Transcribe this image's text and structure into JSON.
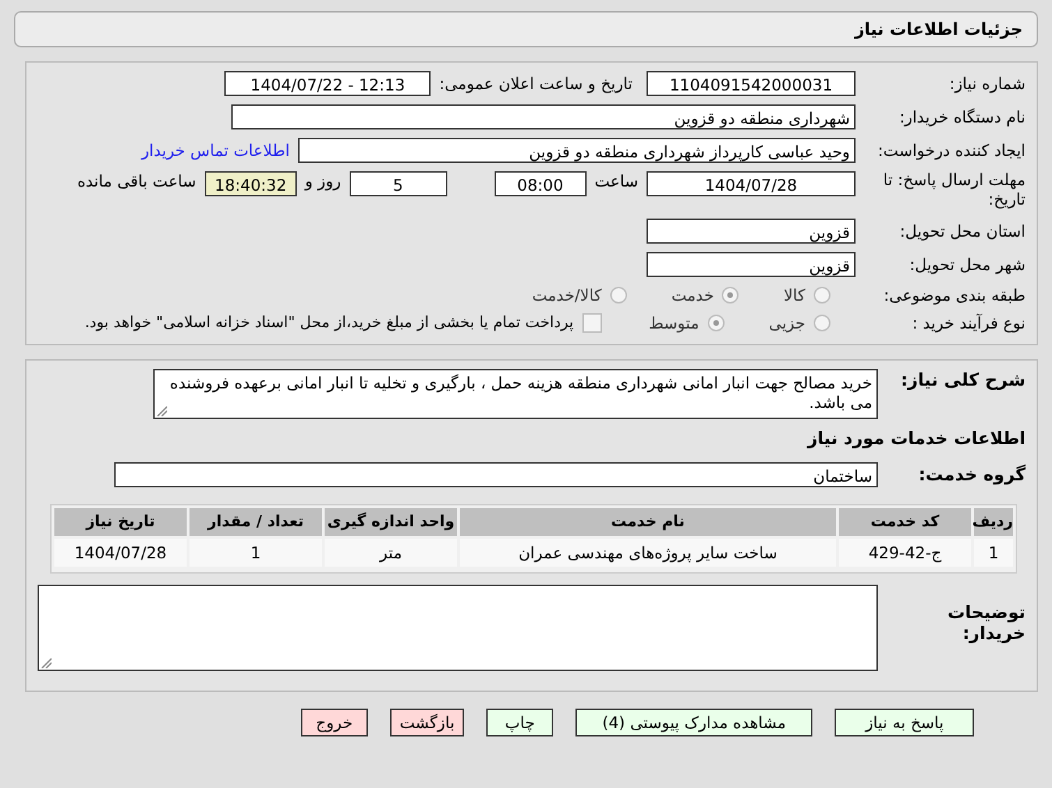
{
  "header": {
    "title": "جزئیات اطلاعات نیاز"
  },
  "need_number": {
    "label": "شماره نیاز:",
    "value": "1104091542000031"
  },
  "announce": {
    "label": "تاریخ و ساعت اعلان عمومی:",
    "value": "1404/07/22 - 12:13"
  },
  "buyer": {
    "label": "نام دستگاه خریدار:",
    "value": "شهرداری منطقه دو قزوین"
  },
  "creator": {
    "label": "ایجاد کننده درخواست:",
    "value": "وحید عباسی کارپرداز شهرداری منطقه دو قزوین",
    "link": "اطلاعات تماس خریدار"
  },
  "deadline": {
    "label": "مهلت ارسال پاسخ: تا تاریخ:",
    "date": "1404/07/28",
    "time_label": "ساعت",
    "time": "08:00",
    "days": "5",
    "days_label": "روز و",
    "remaining": "18:40:32",
    "remaining_label": "ساعت باقی مانده"
  },
  "province": {
    "label": "استان محل تحویل:",
    "value": "قزوین"
  },
  "city": {
    "label": "شهر محل تحویل:",
    "value": "قزوین"
  },
  "category": {
    "label": "طبقه بندی موضوعی:",
    "options": [
      {
        "label": "کالا",
        "selected": false
      },
      {
        "label": "خدمت",
        "selected": true
      },
      {
        "label": "کالا/خدمت",
        "selected": false
      }
    ]
  },
  "process": {
    "label": "نوع فرآیند خرید :",
    "options": [
      {
        "label": "جزیی",
        "selected": false
      },
      {
        "label": "متوسط",
        "selected": true
      }
    ],
    "payment": {
      "checked": false,
      "text": "پرداخت تمام یا بخشی از مبلغ خرید،از محل \"اسناد خزانه اسلامی\" خواهد بود."
    }
  },
  "description": {
    "label": "شرح کلی نیاز:",
    "value": "خرید مصالح جهت انبار امانی شهرداری منطقه هزینه حمل ، بارگیری و تخلیه تا انبار امانی برعهده فروشنده می باشد."
  },
  "services_heading": "اطلاعات خدمات مورد نیاز",
  "service_group": {
    "label": "گروه خدمت:",
    "value": "ساختمان"
  },
  "table": {
    "columns": [
      "ردیف",
      "کد خدمت",
      "نام خدمت",
      "واحد اندازه گیری",
      "تعداد / مقدار",
      "تاریخ نیاز"
    ],
    "rows": [
      [
        "1",
        "ج-42-429",
        "ساخت سایر پروژه‌های مهندسی عمران",
        "متر",
        "1",
        "1404/07/28"
      ]
    ]
  },
  "buyer_notes": {
    "label": "توضیحات خریدار:"
  },
  "buttons": [
    {
      "label": "پاسخ به نیاز",
      "kind": "ok"
    },
    {
      "label": "مشاهده مدارک پیوستی (4)",
      "kind": "ok"
    },
    {
      "label": "چاپ",
      "kind": "ok"
    },
    {
      "label": "بازگشت",
      "kind": "danger"
    },
    {
      "label": "خروج",
      "kind": "danger"
    }
  ]
}
